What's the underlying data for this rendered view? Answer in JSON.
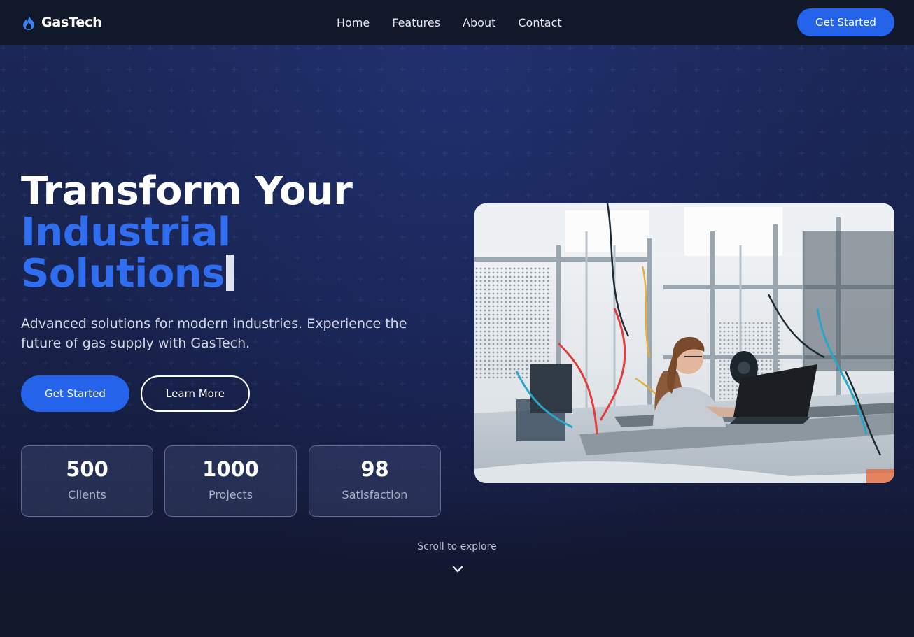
{
  "nav": {
    "brand": "GasTech",
    "links": [
      "Home",
      "Features",
      "About",
      "Contact"
    ],
    "cta": "Get Started"
  },
  "hero": {
    "title_line1": "Transform Your",
    "title_line2": "Industrial",
    "title_line3": "Solutions",
    "subtitle": "Advanced solutions for modern industries. Experience the future of gas supply with GasTech.",
    "primary_button": "Get Started",
    "secondary_button": "Learn More",
    "stats": [
      {
        "value": "500",
        "label": "Clients"
      },
      {
        "value": "1000",
        "label": "Projects"
      },
      {
        "value": "98",
        "label": "Satisfaction"
      }
    ],
    "scroll_hint": "Scroll to explore"
  },
  "colors": {
    "accent": "#2563eb",
    "headline_blue": "#2f6ef0",
    "nav_bg": "#111829",
    "hero_bg": "#18224c"
  },
  "icons": {
    "brand": "flame-icon",
    "scroll": "chevron-down-icon"
  }
}
